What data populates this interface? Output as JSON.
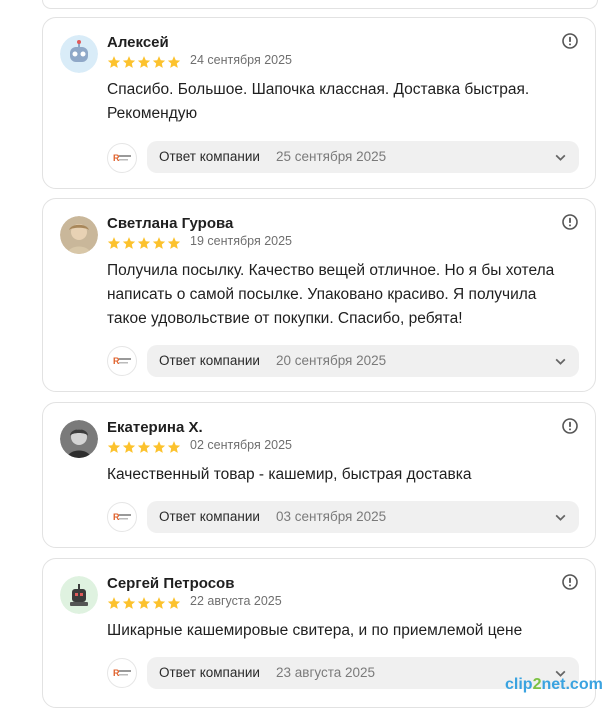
{
  "reviews": [
    {
      "author": "Алексей",
      "rating": 5,
      "date": "24 сентября 2025",
      "text": "Спасибо. Большое. Шапочка классная. Доставка быстрая. Рекомендую",
      "reply_label": "Ответ компании",
      "reply_date": "25 сентября 2025"
    },
    {
      "author": "Светлана Гурова",
      "rating": 5,
      "date": "19 сентября 2025",
      "text": "Получила посылку. Качество вещей отличное. Но я бы хотела написать о самой посылке. Упаковано красиво. Я получила такое удовольствие от покупки. Спасибо, ребята!",
      "reply_label": "Ответ компании",
      "reply_date": "20 сентября 2025"
    },
    {
      "author": "Екатерина Х.",
      "rating": 5,
      "date": "02 сентября 2025",
      "text": "Качественный товар - кашемир, быстрая доставка",
      "reply_label": "Ответ компании",
      "reply_date": "03 сентября 2025"
    },
    {
      "author": "Сергей Петросов",
      "rating": 5,
      "date": "22 августа 2025",
      "text": "Шикарные кашемировые свитера, и по приемлемой цене",
      "reply_label": "Ответ компании",
      "reply_date": "23 августа 2025"
    }
  ],
  "colors": {
    "star": "#fcc22d",
    "reply_bg": "#f0f0f0"
  },
  "watermark": {
    "part1": "clip",
    "part2": "2",
    "part3": "net.com"
  }
}
